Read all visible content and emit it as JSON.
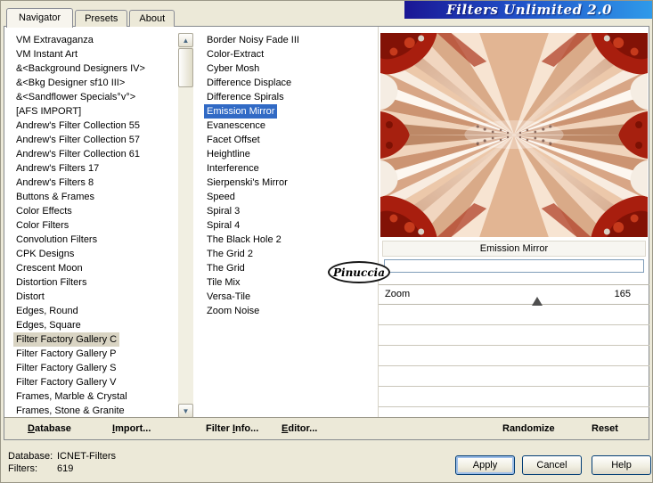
{
  "title_banner": "Filters Unlimited 2.0",
  "tabs": [
    "Navigator",
    "Presets",
    "About"
  ],
  "active_tab_index": 0,
  "categories": {
    "items": [
      "VM Extravaganza",
      "VM Instant Art",
      "&<Background Designers IV>",
      "&<Bkg Designer sf10 III>",
      "&<Sandflower Specials°v°>",
      "[AFS IMPORT]",
      "Andrew's Filter Collection 55",
      "Andrew's Filter Collection 57",
      "Andrew's Filter Collection 61",
      "Andrew's Filters 17",
      "Andrew's Filters 8",
      "Buttons & Frames",
      "Color Effects",
      "Color Filters",
      "Convolution Filters",
      "CPK Designs",
      "Crescent Moon",
      "Distortion Filters",
      "Distort",
      "Edges, Round",
      "Edges, Square",
      "Filter Factory Gallery C",
      "Filter Factory Gallery P",
      "Filter Factory Gallery S",
      "Filter Factory Gallery V",
      "Frames, Marble & Crystal",
      "Frames, Stone & Granite"
    ],
    "selected_index": 21
  },
  "filters": {
    "items": [
      "Border Noisy Fade III",
      "Color-Extract",
      "Cyber Mosh",
      "Difference Displace",
      "Difference Spirals",
      "Emission Mirror",
      "Evanescence",
      "Facet Offset",
      "Heightline",
      "Interference",
      "Sierpenski's Mirror",
      "Speed",
      "Spiral 3",
      "Spiral 4",
      "The Black Hole 2",
      "The Grid 2",
      "The Grid",
      "Tile Mix",
      "Versa-Tile",
      "Zoom Noise"
    ],
    "selected_index": 5
  },
  "preview": {
    "selected_filter_label": "Emission Mirror",
    "filter_input_value": "",
    "watermark": "Pinuccia"
  },
  "controls": {
    "zoom_label": "Zoom",
    "zoom_value": "165"
  },
  "toolbar": {
    "database": "Database",
    "import": "Import...",
    "filter_info": "Filter Info...",
    "editor": "Editor...",
    "randomize": "Randomize",
    "reset": "Reset"
  },
  "status": {
    "database_label": "Database:",
    "database_value": "ICNET-Filters",
    "filters_label": "Filters:",
    "filters_value": "619"
  },
  "buttons": {
    "apply": "Apply",
    "cancel": "Cancel",
    "help": "Help"
  },
  "colors": {
    "window_background": "#ECE9D8",
    "selection_blue": "#316AC5",
    "banner_gradient_start": "#1A1694",
    "banner_gradient_end": "#2F9BEA"
  }
}
